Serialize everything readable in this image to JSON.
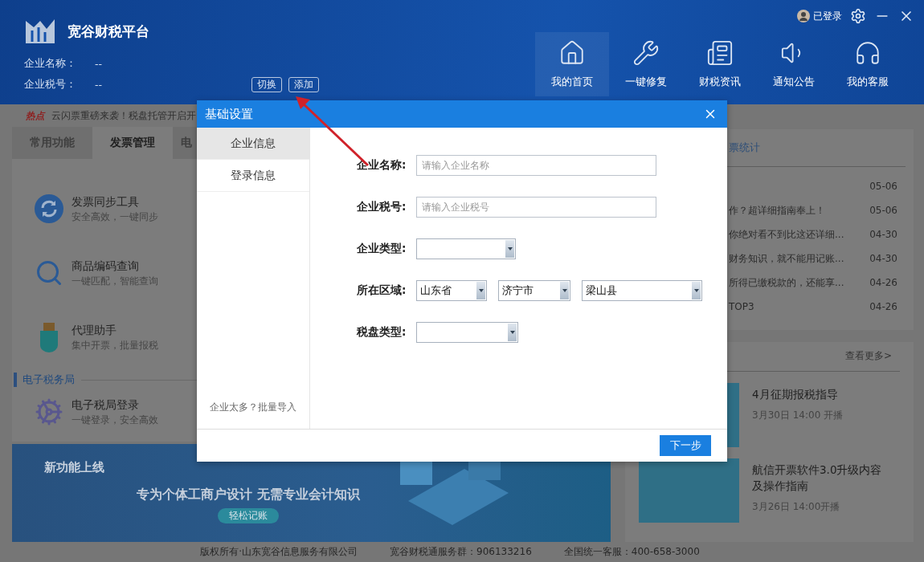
{
  "header": {
    "app_title": "宽谷财税平台",
    "info": [
      {
        "label": "企业名称：",
        "value": "--"
      },
      {
        "label": "企业税号：",
        "value": "--"
      }
    ],
    "buttons": [
      "切换",
      "添加"
    ],
    "user": "已登录",
    "nav": [
      {
        "label": "我的首页",
        "selected": true
      },
      {
        "label": "一键修复",
        "selected": false
      },
      {
        "label": "财税资讯",
        "selected": false
      },
      {
        "label": "通知公告",
        "selected": false
      },
      {
        "label": "我的客服",
        "selected": false
      }
    ]
  },
  "hot": {
    "tag": "热点",
    "text": "云闪票重磅来袭！税盘托管开启开"
  },
  "tabs": [
    {
      "label": "常用功能",
      "selected": false
    },
    {
      "label": "发票管理",
      "selected": true
    },
    {
      "label": "电",
      "selected": false
    }
  ],
  "tools": [
    {
      "kind": "sync",
      "title": "发票同步工具",
      "subtitle": "安全高效，一键同步"
    },
    {
      "kind": "search",
      "title": "商品编码查询",
      "subtitle": "一键匹配，智能查询"
    },
    {
      "kind": "usb",
      "title": "代理助手",
      "subtitle": "集中开票，批量报税"
    }
  ],
  "section_title": "电子税务局",
  "tax_tools": [
    {
      "kind": "gear",
      "title": "电子税局登录",
      "subtitle": "一键登录，安全高效"
    }
  ],
  "banner": {
    "badge": "新功能上线",
    "slogan": "专为个体工商户设计 无需专业会计知识",
    "button": "轻松记账"
  },
  "news_card": {
    "title": "票统计",
    "rows": [
      {
        "date": "05-06"
      },
      {
        "text": "作？超详细指南奉上！",
        "date": "05-06"
      },
      {
        "text": "你绝对看不到比这还详细...",
        "date": "04-30"
      },
      {
        "text": "财务知识，就不能用记账...",
        "date": "04-30"
      },
      {
        "text": "所得已缴税款的，还能享...",
        "date": "04-26"
      },
      {
        "text": "TOP3",
        "date": "04-26"
      }
    ]
  },
  "live_card": {
    "more": "查看更多>",
    "items": [
      {
        "title": "4月征期报税指导",
        "time": "3月30日 14:00 开播"
      },
      {
        "title": "航信开票软件3.0升级内容及操作指南",
        "time": "3月26日 14:00开播"
      }
    ]
  },
  "footer": [
    "版权所有·山东宽谷信息服务有限公司",
    "宽谷财税通服务群：906133216",
    "全国统一客服：400-658-3000"
  ],
  "dialog": {
    "title": "基础设置",
    "sidebar": [
      {
        "label": "企业信息",
        "selected": true
      },
      {
        "label": "登录信息",
        "selected": false
      }
    ],
    "batch_link": "企业太多？批量导入",
    "fields": [
      {
        "kind": "input",
        "label": "企业名称:",
        "placeholder": "请输入企业名称"
      },
      {
        "kind": "input",
        "label": "企业税号:",
        "placeholder": "请输入企业税号"
      },
      {
        "kind": "select",
        "label": "企业类型:"
      },
      {
        "kind": "select",
        "label": "所在区域:",
        "values": [
          "山东省",
          "济宁市",
          "梁山县"
        ]
      },
      {
        "kind": "select",
        "label": "税盘类型:"
      }
    ],
    "next": "下一步"
  }
}
